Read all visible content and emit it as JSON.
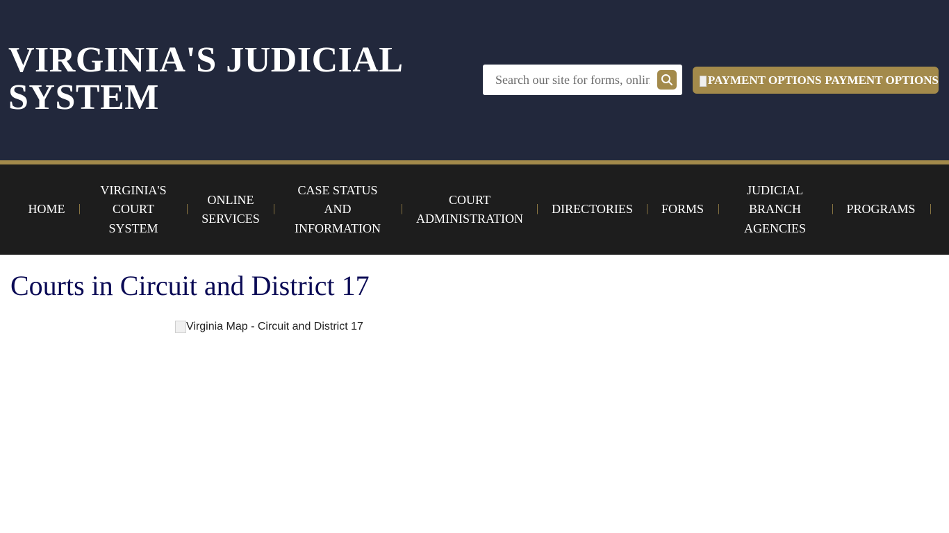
{
  "header": {
    "site_title_line1": "VIRGINIA'S JUDICIAL",
    "site_title_line2": "SYSTEM",
    "search": {
      "placeholder": "Search our site for forms, online services, and more",
      "button_icon": "search-icon"
    },
    "payment": {
      "img_alt": "PAYMENT OPTIONS",
      "label": "PAYMENT OPTIONS"
    },
    "colors": {
      "header_bg": "#22283c",
      "accent_gold": "#a38a4b",
      "nav_bg": "#1d1d1d"
    }
  },
  "nav": {
    "items": [
      {
        "lines": [
          "HOME"
        ]
      },
      {
        "lines": [
          "VIRGINIA'S",
          "COURT",
          "SYSTEM"
        ]
      },
      {
        "lines": [
          "ONLINE",
          "SERVICES"
        ]
      },
      {
        "lines": [
          "CASE STATUS",
          "AND",
          "INFORMATION"
        ]
      },
      {
        "lines": [
          "COURT",
          "ADMINISTRATION"
        ]
      },
      {
        "lines": [
          "DIRECTORIES"
        ]
      },
      {
        "lines": [
          "FORMS"
        ]
      },
      {
        "lines": [
          "JUDICIAL",
          "BRANCH",
          "AGENCIES"
        ]
      },
      {
        "lines": [
          "PROGRAMS"
        ]
      }
    ],
    "separator": "|"
  },
  "main": {
    "page_title": "Courts in Circuit and District 17",
    "map_img_alt": "Virginia Map - Circuit and District 17"
  }
}
